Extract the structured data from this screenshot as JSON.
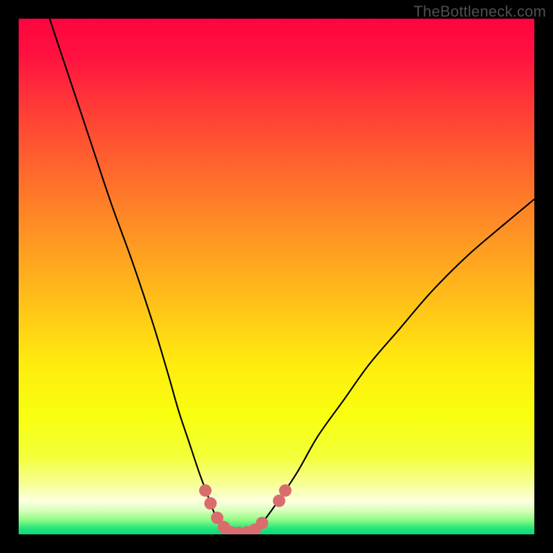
{
  "watermark": "TheBottleneck.com",
  "gradient_stops": [
    {
      "offset": 0.0,
      "color": "#ff0440"
    },
    {
      "offset": 0.07,
      "color": "#ff1140"
    },
    {
      "offset": 0.18,
      "color": "#ff3e36"
    },
    {
      "offset": 0.3,
      "color": "#ff6a2c"
    },
    {
      "offset": 0.42,
      "color": "#ff9423"
    },
    {
      "offset": 0.55,
      "color": "#ffc119"
    },
    {
      "offset": 0.67,
      "color": "#ffec0f"
    },
    {
      "offset": 0.77,
      "color": "#f8ff0e"
    },
    {
      "offset": 0.85,
      "color": "#f3ff3a"
    },
    {
      "offset": 0.905,
      "color": "#f7ff9b"
    },
    {
      "offset": 0.935,
      "color": "#fcffe0"
    },
    {
      "offset": 0.955,
      "color": "#d5ffb8"
    },
    {
      "offset": 0.972,
      "color": "#8ffc85"
    },
    {
      "offset": 0.988,
      "color": "#28e57a"
    },
    {
      "offset": 1.0,
      "color": "#04da83"
    }
  ],
  "chart_data": {
    "type": "line",
    "title": "",
    "xlabel": "",
    "ylabel": "",
    "xlim": [
      0,
      100
    ],
    "ylim": [
      0,
      100
    ],
    "series": [
      {
        "name": "bottleneck-curve",
        "x": [
          6,
          10,
          14,
          18,
          22,
          26,
          29,
          31,
          33,
          35,
          36.5,
          38,
          39.5,
          41,
          43,
          45,
          47,
          50,
          54,
          58,
          63,
          68,
          74,
          80,
          87,
          94,
          100
        ],
        "y": [
          100,
          88,
          76,
          64,
          53,
          41,
          31,
          24,
          18,
          12,
          8,
          4,
          1.5,
          0.3,
          0.3,
          0.6,
          2,
          6,
          12,
          19,
          26,
          33,
          40,
          47,
          54,
          60,
          65
        ]
      }
    ],
    "markers": {
      "name": "highlight-dots",
      "color": "#d96d6d",
      "radius_px": 9,
      "points": [
        {
          "x": 36.2,
          "y": 8.5
        },
        {
          "x": 37.2,
          "y": 6.0
        },
        {
          "x": 38.5,
          "y": 3.2
        },
        {
          "x": 39.8,
          "y": 1.4
        },
        {
          "x": 41.2,
          "y": 0.4
        },
        {
          "x": 42.7,
          "y": 0.3
        },
        {
          "x": 44.3,
          "y": 0.4
        },
        {
          "x": 45.8,
          "y": 0.9
        },
        {
          "x": 47.2,
          "y": 2.2
        },
        {
          "x": 50.5,
          "y": 6.5
        },
        {
          "x": 51.7,
          "y": 8.5
        }
      ]
    }
  }
}
